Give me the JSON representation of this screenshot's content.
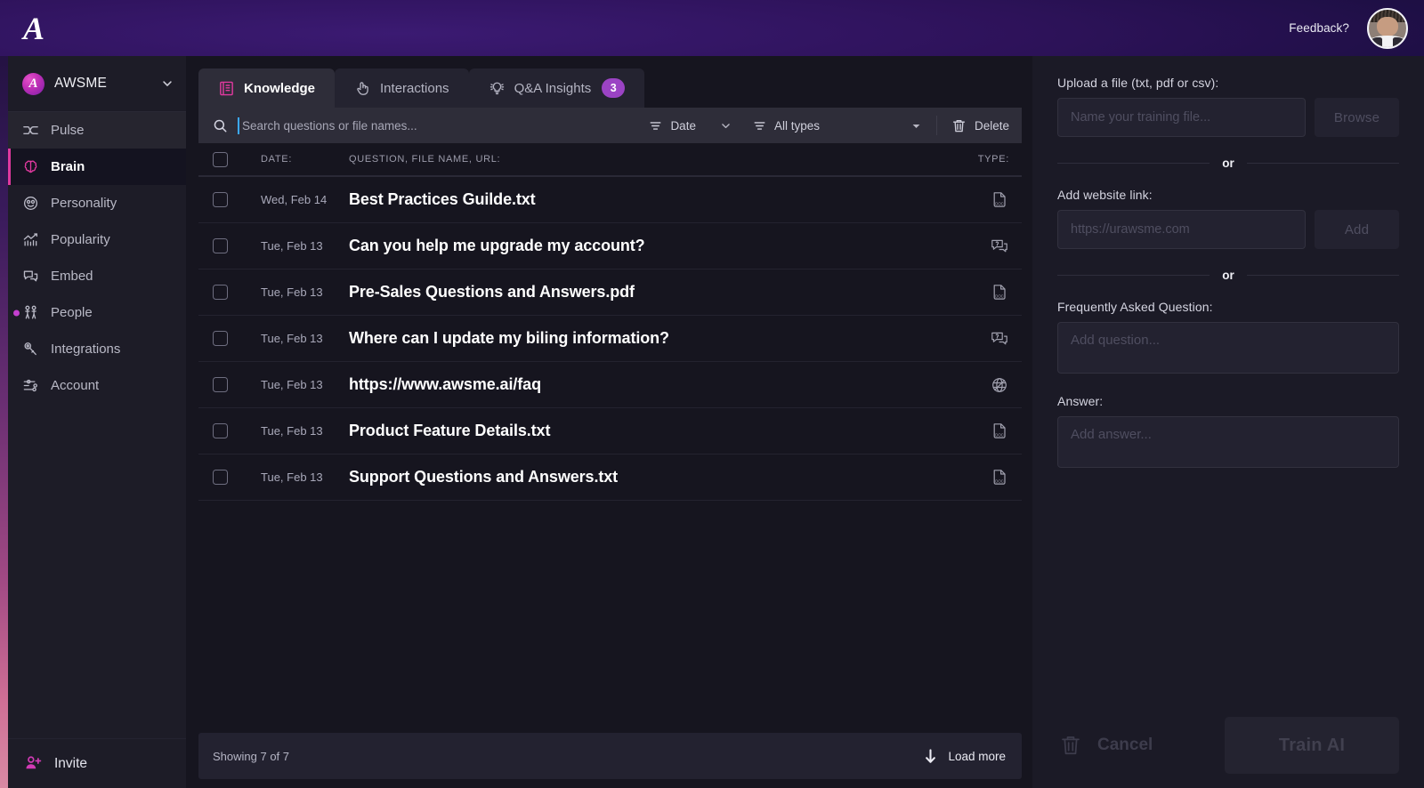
{
  "header": {
    "logo": "A",
    "feedback_label": "Feedback?",
    "avatar_name": "user-avatar"
  },
  "sidebar": {
    "workspace": {
      "initial": "A",
      "name": "AWSME",
      "caret_icon": "chevron-down-icon"
    },
    "items": [
      {
        "label": "Pulse",
        "icon": "pulse-icon",
        "state": "hover"
      },
      {
        "label": "Brain",
        "icon": "brain-icon",
        "state": "active"
      },
      {
        "label": "Personality",
        "icon": "personality-icon",
        "state": ""
      },
      {
        "label": "Popularity",
        "icon": "popularity-icon",
        "state": ""
      },
      {
        "label": "Embed",
        "icon": "embed-icon",
        "state": ""
      },
      {
        "label": "People",
        "icon": "people-icon",
        "state": "dot"
      },
      {
        "label": "Integrations",
        "icon": "key-icon",
        "state": ""
      },
      {
        "label": "Account",
        "icon": "sliders-icon",
        "state": ""
      }
    ],
    "invite": {
      "label": "Invite",
      "icon": "add-person-icon"
    }
  },
  "tabs": [
    {
      "label": "Knowledge",
      "icon": "book-icon",
      "state": "active",
      "badge": ""
    },
    {
      "label": "Interactions",
      "icon": "hand-tap-icon",
      "state": "semi",
      "badge": ""
    },
    {
      "label": "Q&A Insights",
      "icon": "lightbulb-icon",
      "state": "semi",
      "badge": "3"
    }
  ],
  "toolbar": {
    "search_placeholder": "Search questions or file names...",
    "search_value": "",
    "search_icon": "search-icon",
    "date_filter": "Date",
    "type_filter": "All types",
    "delete_label": "Delete",
    "delete_icon": "trash-icon",
    "filter_icon": "filter-icon",
    "caret_icon": "chevron-down-icon"
  },
  "table": {
    "headers": {
      "date": "DATE:",
      "name": "QUESTION, FILE NAME, URL:",
      "type": "TYPE:"
    },
    "rows": [
      {
        "date": "Wed, Feb 14",
        "name": "Best Practices Guilde.txt",
        "type": "doc"
      },
      {
        "date": "Tue, Feb 13",
        "name": "Can you help me upgrade my account?",
        "type": "qa"
      },
      {
        "date": "Tue, Feb 13",
        "name": "Pre-Sales Questions and Answers.pdf",
        "type": "doc"
      },
      {
        "date": "Tue, Feb 13",
        "name": "Where can I update my biling information?",
        "type": "qa"
      },
      {
        "date": "Tue, Feb 13",
        "name": "https://www.awsme.ai/faq",
        "type": "web"
      },
      {
        "date": "Tue, Feb 13",
        "name": "Product Feature Details.txt",
        "type": "doc"
      },
      {
        "date": "Tue, Feb 13",
        "name": "Support Questions and Answers.txt",
        "type": "doc"
      }
    ]
  },
  "footer": {
    "showing": "Showing 7 of 7",
    "load_more": "Load more",
    "load_more_icon": "arrow-down-icon"
  },
  "right_panel": {
    "upload_label": "Upload a file (txt, pdf or csv):",
    "upload_placeholder": "Name your training file...",
    "upload_value": "",
    "browse_label": "Browse",
    "or_1": "or",
    "link_label": "Add website link:",
    "link_placeholder": "https://urawsme.com",
    "link_value": "",
    "add_label": "Add",
    "or_2": "or",
    "faq_label": "Frequently Asked Question:",
    "faq_placeholder": "Add question...",
    "faq_value": "",
    "answer_label": "Answer:",
    "answer_placeholder": "Add answer...",
    "answer_value": "",
    "cancel_label": "Cancel",
    "cancel_icon": "trash-icon",
    "train_label": "Train AI"
  },
  "colors": {
    "accent_pink": "#e0399f",
    "accent_purple": "#9b43c4",
    "header_purple": "#3b1a72",
    "panel_bg": "#2e2d39",
    "main_bg": "#16151f",
    "sidebar_bg": "#1d1c27",
    "caret_blue": "#3ba9ff"
  }
}
